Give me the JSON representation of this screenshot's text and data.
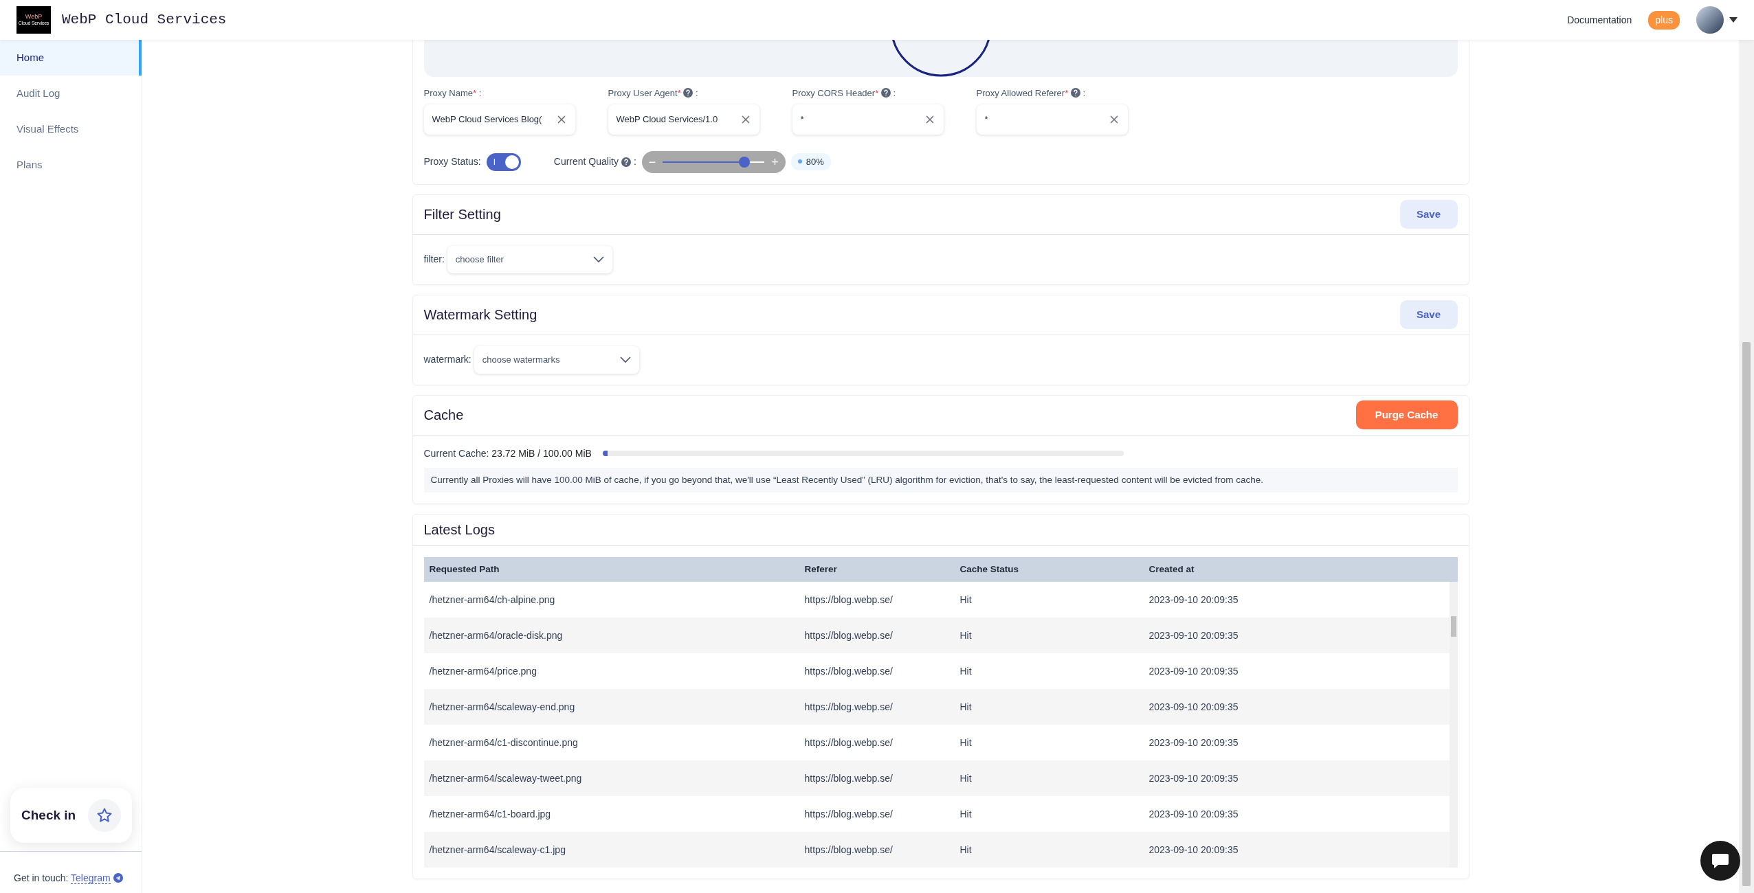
{
  "header": {
    "logo_text": [
      "WebP",
      "Cloud Services"
    ],
    "title": "WebP Cloud Services",
    "links": [
      "Documentation"
    ],
    "badge": "plus"
  },
  "sidebar": {
    "items": [
      {
        "label": "Home",
        "selected": true
      },
      {
        "label": "Audit Log",
        "selected": false
      },
      {
        "label": "Visual Effects",
        "selected": false
      },
      {
        "label": "Plans",
        "selected": false
      }
    ],
    "checkin": {
      "label": "Check in"
    },
    "contact": {
      "text": "Get in touch:",
      "link": "Telegram"
    }
  },
  "proxy_form": {
    "fields": [
      {
        "label": "Proxy Name",
        "mark": "*",
        "help": false,
        "colon": ":",
        "value": "WebP Cloud Services Blog("
      },
      {
        "label": "Proxy User Agent",
        "mark": "*",
        "help": true,
        "colon": ":",
        "value": "WebP Cloud Services/1.0"
      },
      {
        "label": "Proxy CORS Header",
        "mark": "*",
        "help": true,
        "colon": ":",
        "value": "*"
      },
      {
        "label": "Proxy Allowed Referer",
        "mark": "*",
        "help": true,
        "colon": ":",
        "value": "*"
      }
    ],
    "status": {
      "label": "Proxy Status:",
      "on": true,
      "toggle_text": "I"
    },
    "quality": {
      "label": "Current Quality",
      "help": true,
      "colon": ":",
      "minus": "−",
      "plus": "+",
      "level": 0.8,
      "reading": "80%"
    }
  },
  "filter": {
    "title": "Filter Setting",
    "button": "Save",
    "label": "filter:",
    "placeholder": "choose filter"
  },
  "watermark": {
    "title": "Watermark Setting",
    "button": "Save",
    "label": "watermark:",
    "placeholder": "choose watermarks"
  },
  "cache": {
    "title": "Cache",
    "button": "Purge Cache",
    "label": "Current Cache:",
    "value": "23.72 MiB / 100.00 MiB",
    "level": 0.01,
    "note": "Currently all Proxies will have 100.00 MiB of cache, if you go beyond that, we'll use “Least Recently Used” (LRU) algorithm for eviction, that's to say, the least-requested content will be evicted from cache."
  },
  "logs": {
    "title": "Latest Logs",
    "columns": [
      "Requested Path",
      "Referer",
      "Cache Status",
      "Created at"
    ],
    "rows": [
      [
        "/hetzner-arm64/ch-alpine.png",
        "https://blog.webp.se/",
        "Hit",
        "2023-09-10 20:09:35"
      ],
      [
        "/hetzner-arm64/oracle-disk.png",
        "https://blog.webp.se/",
        "Hit",
        "2023-09-10 20:09:35"
      ],
      [
        "/hetzner-arm64/price.png",
        "https://blog.webp.se/",
        "Hit",
        "2023-09-10 20:09:35"
      ],
      [
        "/hetzner-arm64/scaleway-end.png",
        "https://blog.webp.se/",
        "Hit",
        "2023-09-10 20:09:35"
      ],
      [
        "/hetzner-arm64/c1-discontinue.png",
        "https://blog.webp.se/",
        "Hit",
        "2023-09-10 20:09:35"
      ],
      [
        "/hetzner-arm64/scaleway-tweet.png",
        "https://blog.webp.se/",
        "Hit",
        "2023-09-10 20:09:35"
      ],
      [
        "/hetzner-arm64/c1-board.jpg",
        "https://blog.webp.se/",
        "Hit",
        "2023-09-10 20:09:35"
      ],
      [
        "/hetzner-arm64/scaleway-c1.jpg",
        "https://blog.webp.se/",
        "Hit",
        "2023-09-10 20:09:35"
      ]
    ]
  }
}
